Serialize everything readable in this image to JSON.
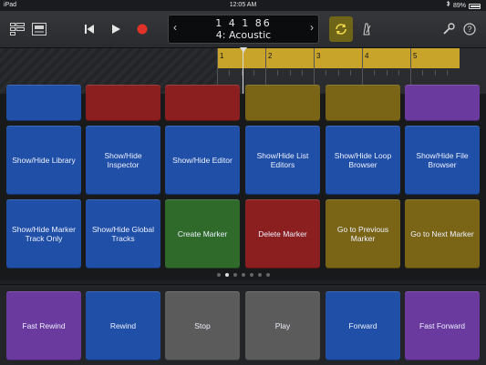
{
  "status_bar": {
    "device": "iPad",
    "time": "12:05 AM",
    "battery": "89%"
  },
  "toolbar": {
    "lcd": {
      "position": "1  4  1    86",
      "track_name": "4: Acoustic",
      "prev_arrow": "‹",
      "next_arrow": "›"
    }
  },
  "ruler": {
    "bars": [
      "1",
      "2",
      "3",
      "4",
      "5"
    ]
  },
  "colors": {
    "blue": "#1f4fa6",
    "red": "#8b1f1f",
    "olive": "#7a6516",
    "purple": "#6a3a9e",
    "green": "#2f6a2a",
    "gray": "#5b5b5b",
    "cycle_yellow": "#c9a42a",
    "record_red": "#e0312b"
  },
  "partial_row": [
    {
      "color": "blue"
    },
    {
      "color": "red"
    },
    {
      "color": "red"
    },
    {
      "color": "olive"
    },
    {
      "color": "olive"
    },
    {
      "color": "purple"
    }
  ],
  "row1": [
    {
      "label": "Show/Hide Library",
      "color": "blue"
    },
    {
      "label": "Show/Hide Inspector",
      "color": "blue"
    },
    {
      "label": "Show/Hide Editor",
      "color": "blue"
    },
    {
      "label": "Show/Hide List Editors",
      "color": "blue"
    },
    {
      "label": "Show/Hide Loop Browser",
      "color": "blue"
    },
    {
      "label": "Show/Hide File Browser",
      "color": "blue"
    }
  ],
  "row2": [
    {
      "label": "Show/Hide Marker Track Only",
      "color": "blue"
    },
    {
      "label": "Show/Hide Global Tracks",
      "color": "blue"
    },
    {
      "label": "Create Marker",
      "color": "green"
    },
    {
      "label": "Delete Marker",
      "color": "red"
    },
    {
      "label": "Go to Previous Marker",
      "color": "olive"
    },
    {
      "label": "Go to Next Marker",
      "color": "olive"
    }
  ],
  "pager": {
    "count": 7,
    "active": 1
  },
  "transport": [
    {
      "label": "Fast Rewind",
      "color": "purple"
    },
    {
      "label": "Rewind",
      "color": "blue"
    },
    {
      "label": "Stop",
      "color": "gray"
    },
    {
      "label": "Play",
      "color": "gray"
    },
    {
      "label": "Forward",
      "color": "blue"
    },
    {
      "label": "Fast Forward",
      "color": "purple"
    }
  ]
}
